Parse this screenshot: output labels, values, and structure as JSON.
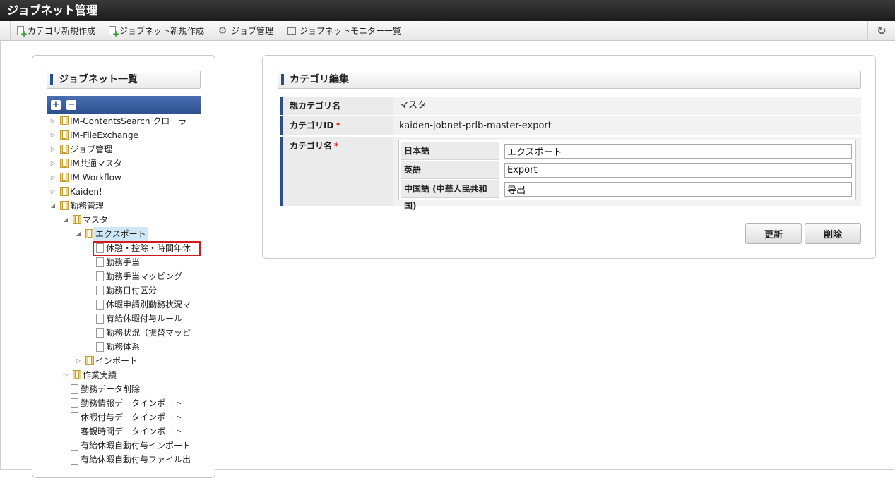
{
  "app": {
    "title": "ジョブネット管理"
  },
  "toolbar": {
    "items": [
      {
        "label": "カテゴリ新規作成",
        "icon": "doc-plus-icon"
      },
      {
        "label": "ジョブネット新規作成",
        "icon": "doc-plus-icon"
      },
      {
        "label": "ジョブ管理",
        "icon": "gear-icon"
      },
      {
        "label": "ジョブネットモニター一覧",
        "icon": "monitor-icon"
      }
    ],
    "refresh_icon": "refresh-icon"
  },
  "left": {
    "title": "ジョブネット一覧",
    "expand_all": "+",
    "collapse_all": "−",
    "tree": [
      {
        "label": "IM-ContentsSearch クローラ",
        "depth": 0,
        "type": "folder",
        "state": "collapsed"
      },
      {
        "label": "IM-FileExchange",
        "depth": 0,
        "type": "folder",
        "state": "collapsed"
      },
      {
        "label": "ジョブ管理",
        "depth": 0,
        "type": "folder",
        "state": "collapsed"
      },
      {
        "label": "IM共通マスタ",
        "depth": 0,
        "type": "folder",
        "state": "collapsed"
      },
      {
        "label": "IM-Workflow",
        "depth": 0,
        "type": "folder",
        "state": "collapsed"
      },
      {
        "label": "Kaiden!",
        "depth": 0,
        "type": "folder",
        "state": "collapsed"
      },
      {
        "label": "勤務管理",
        "depth": 0,
        "type": "folder",
        "state": "expanded"
      },
      {
        "label": "マスタ",
        "depth": 1,
        "type": "folder",
        "state": "expanded"
      },
      {
        "label": "エクスポート",
        "depth": 2,
        "type": "folder",
        "state": "expanded",
        "selected": true
      },
      {
        "label": "休憩・控除・時間年休",
        "depth": 3,
        "type": "file",
        "highlighted": true
      },
      {
        "label": "勤務手当",
        "depth": 3,
        "type": "file"
      },
      {
        "label": "勤務手当マッピング",
        "depth": 3,
        "type": "file"
      },
      {
        "label": "勤務日付区分",
        "depth": 3,
        "type": "file"
      },
      {
        "label": "休暇申請別勤務状況マ",
        "depth": 3,
        "type": "file"
      },
      {
        "label": "有給休暇付与ルール",
        "depth": 3,
        "type": "file"
      },
      {
        "label": "勤務状況（振替マッピ",
        "depth": 3,
        "type": "file"
      },
      {
        "label": "勤務体系",
        "depth": 3,
        "type": "file"
      },
      {
        "label": "インポート",
        "depth": 2,
        "type": "folder",
        "state": "collapsed"
      },
      {
        "label": "作業実績",
        "depth": 1,
        "type": "folder",
        "state": "collapsed"
      },
      {
        "label": "勤務データ削除",
        "depth": 1,
        "type": "file"
      },
      {
        "label": "勤務情報データインポート",
        "depth": 1,
        "type": "file"
      },
      {
        "label": "休暇付与データインポート",
        "depth": 1,
        "type": "file"
      },
      {
        "label": "客観時間データインポート",
        "depth": 1,
        "type": "file"
      },
      {
        "label": "有給休暇自動付与インポート",
        "depth": 1,
        "type": "file"
      },
      {
        "label": "有給休暇自動付与ファイル出",
        "depth": 1,
        "type": "file"
      }
    ]
  },
  "right": {
    "title": "カテゴリ編集",
    "parent_label": "親カテゴリ名",
    "parent_value": "マスタ",
    "id_label": "カテゴリID",
    "id_value": "kaiden-jobnet-prlb-master-export",
    "name_label": "カテゴリ名",
    "required_mark": "*",
    "names": [
      {
        "lang": "日本語",
        "value": "エクスポート"
      },
      {
        "lang": "英語",
        "value": "Export"
      },
      {
        "lang": "中国語 (中華人民共和国)",
        "value": "导出"
      }
    ],
    "update_label": "更新",
    "delete_label": "削除"
  },
  "colors": {
    "accent": "#2b4f8c",
    "highlight": "#d21a1a",
    "selected": "#cfe8f7"
  }
}
